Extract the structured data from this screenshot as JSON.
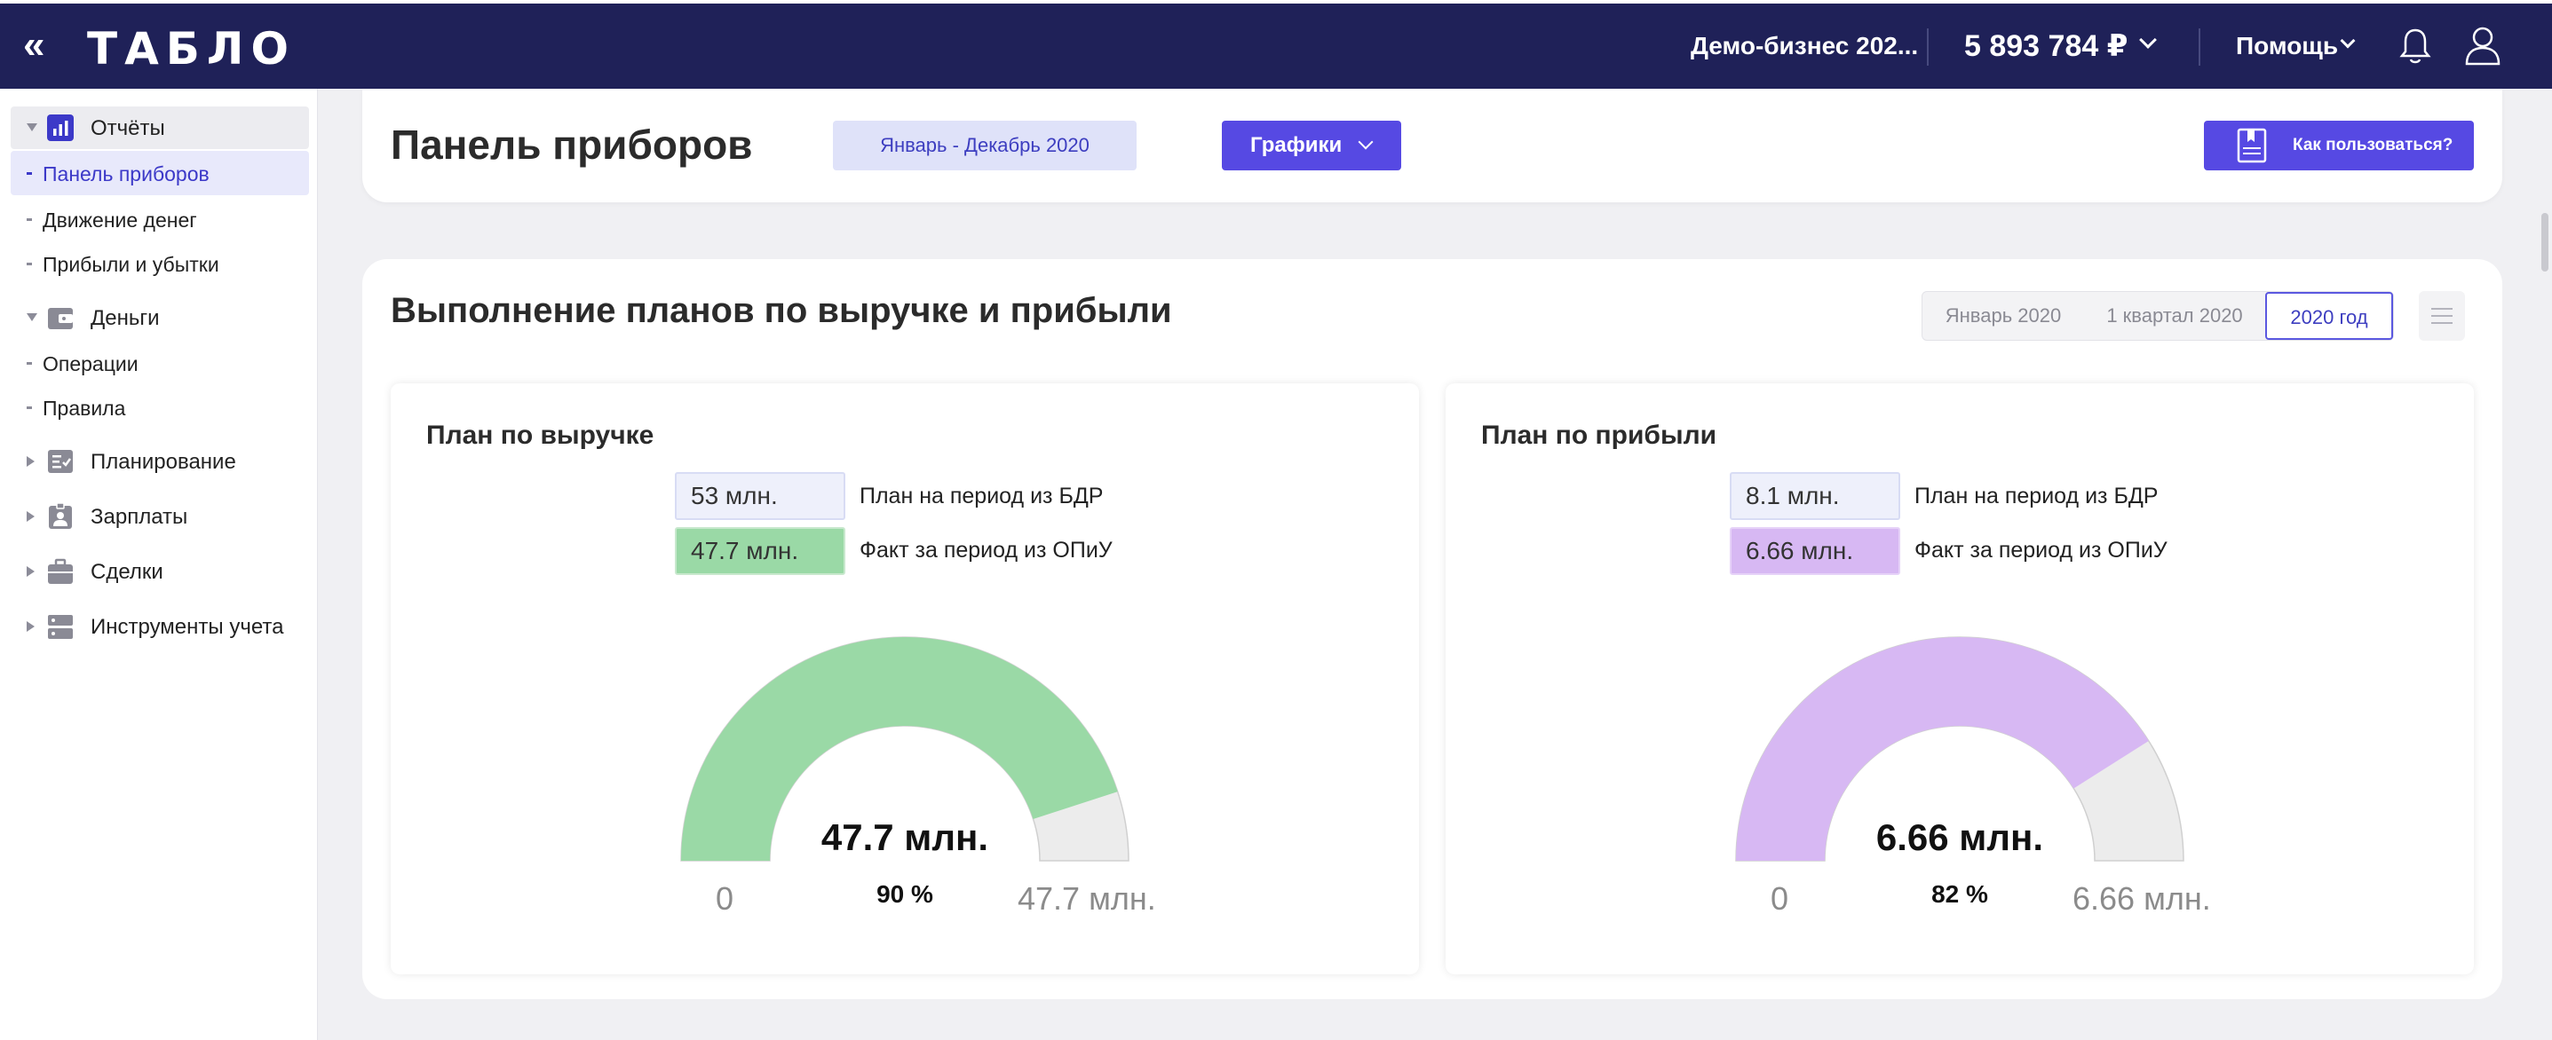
{
  "topbar": {
    "logo": "ТАБЛО",
    "company": "Демо-бизнес 202...",
    "balance": "5 893 784 ₽",
    "help": "Помощь"
  },
  "sidebar": {
    "groups": [
      {
        "label": "Отчёты",
        "icon": "chart-icon",
        "expanded": true,
        "items": [
          {
            "label": "Панель приборов",
            "active": true
          },
          {
            "label": "Движение денег"
          },
          {
            "label": "Прибыли и убытки"
          }
        ]
      },
      {
        "label": "Деньги",
        "icon": "wallet-icon",
        "expanded": true,
        "items": [
          {
            "label": "Операции"
          },
          {
            "label": "Правила"
          }
        ]
      },
      {
        "label": "Планирование",
        "icon": "checklist-icon",
        "expanded": false
      },
      {
        "label": "Зарплаты",
        "icon": "badge-icon",
        "expanded": false
      },
      {
        "label": "Сделки",
        "icon": "briefcase-icon",
        "expanded": false
      },
      {
        "label": "Инструменты учета",
        "icon": "server-icon",
        "expanded": false
      }
    ]
  },
  "header": {
    "title": "Панель приборов",
    "period": "Январь - Декабрь 2020",
    "charts_button": "Графики",
    "howto_button": "Как пользоваться?"
  },
  "section": {
    "title": "Выполнение планов по выручке и прибыли",
    "periods": [
      "Январь 2020",
      "1 квартал 2020",
      "2020 год"
    ],
    "active_period": "2020 год"
  },
  "panels": [
    {
      "title": "План по выручке",
      "plan_value": "53 млн.",
      "plan_label": "План на период из БДР",
      "fact_value": "47.7 млн.",
      "fact_label": "Факт за период из ОПиУ",
      "gauge_value": "47.7 млн.",
      "gauge_pct": "90 %",
      "gauge_min": "0",
      "gauge_max": "47.7 млн.",
      "fraction": 0.9,
      "color": "#9ad9a6",
      "fact_bg": "#9ad9a6"
    },
    {
      "title": "План по прибыли",
      "plan_value": "8.1 млн.",
      "plan_label": "План на период из БДР",
      "fact_value": "6.66 млн.",
      "fact_label": "Факт за период из ОПиУ",
      "gauge_value": "6.66 млн.",
      "gauge_pct": "82 %",
      "gauge_min": "0",
      "gauge_max": "6.66 млн.",
      "fraction": 0.82,
      "color": "#d7b8f3",
      "fact_bg": "#d7b8f3"
    }
  ],
  "colors": {
    "topbar_bg": "#1f2158",
    "accent": "#5649e3",
    "gauge_remaining": "#ececec"
  }
}
